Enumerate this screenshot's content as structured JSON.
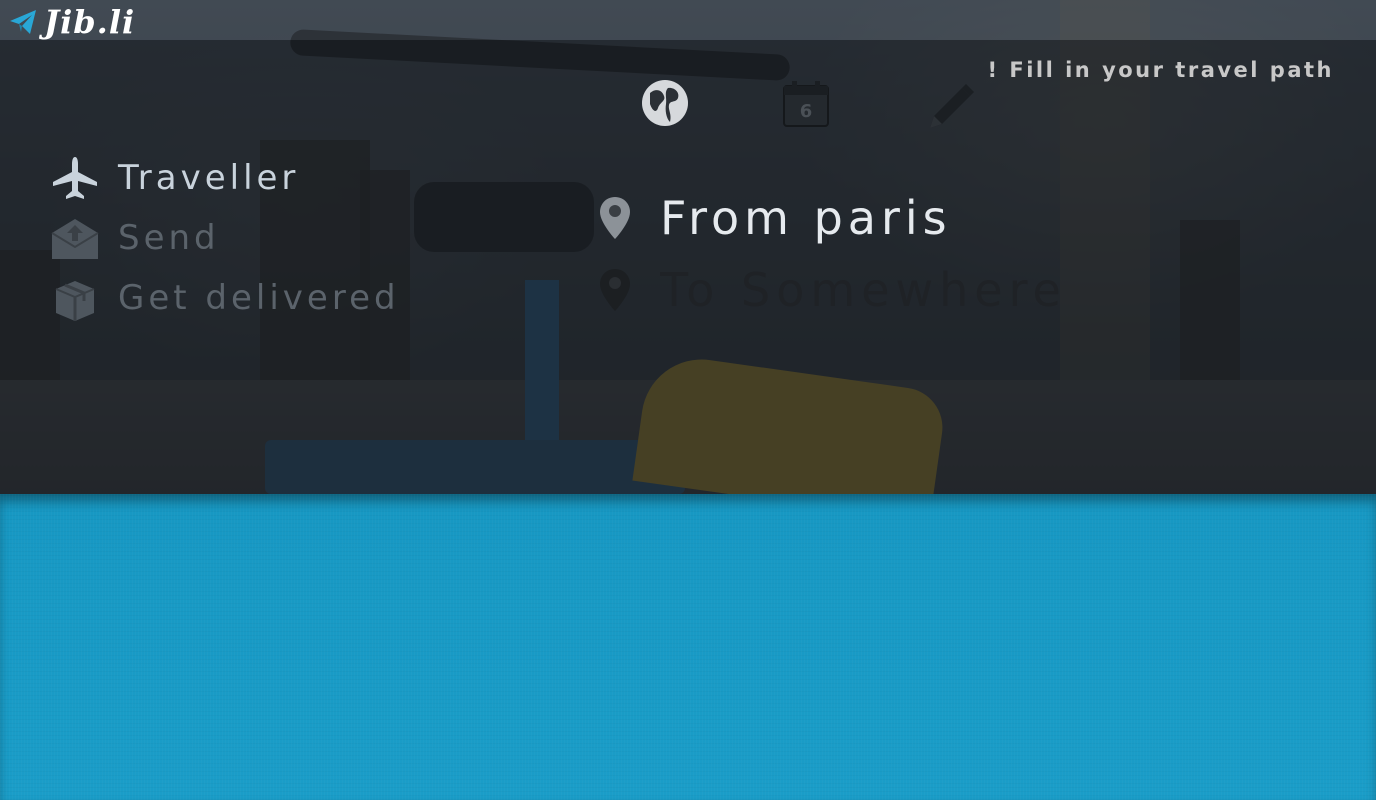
{
  "brand": {
    "name": "Jib.li",
    "accent": "#1a9dc8"
  },
  "hint": {
    "text": "!  Fill in your travel path"
  },
  "steps": [
    {
      "icon": "globe-icon",
      "active": true
    },
    {
      "icon": "calendar-icon",
      "label": "6",
      "active": false
    },
    {
      "icon": "pencil-icon",
      "active": false
    }
  ],
  "menu": {
    "items": [
      {
        "label": "Traveller",
        "icon": "airplane-icon",
        "active": true
      },
      {
        "label": "Send",
        "icon": "outbox-icon",
        "active": false
      },
      {
        "label": "Get delivered",
        "icon": "gift-box-icon",
        "active": false
      }
    ]
  },
  "route": {
    "from": "From paris",
    "to": "To Somewhere"
  }
}
